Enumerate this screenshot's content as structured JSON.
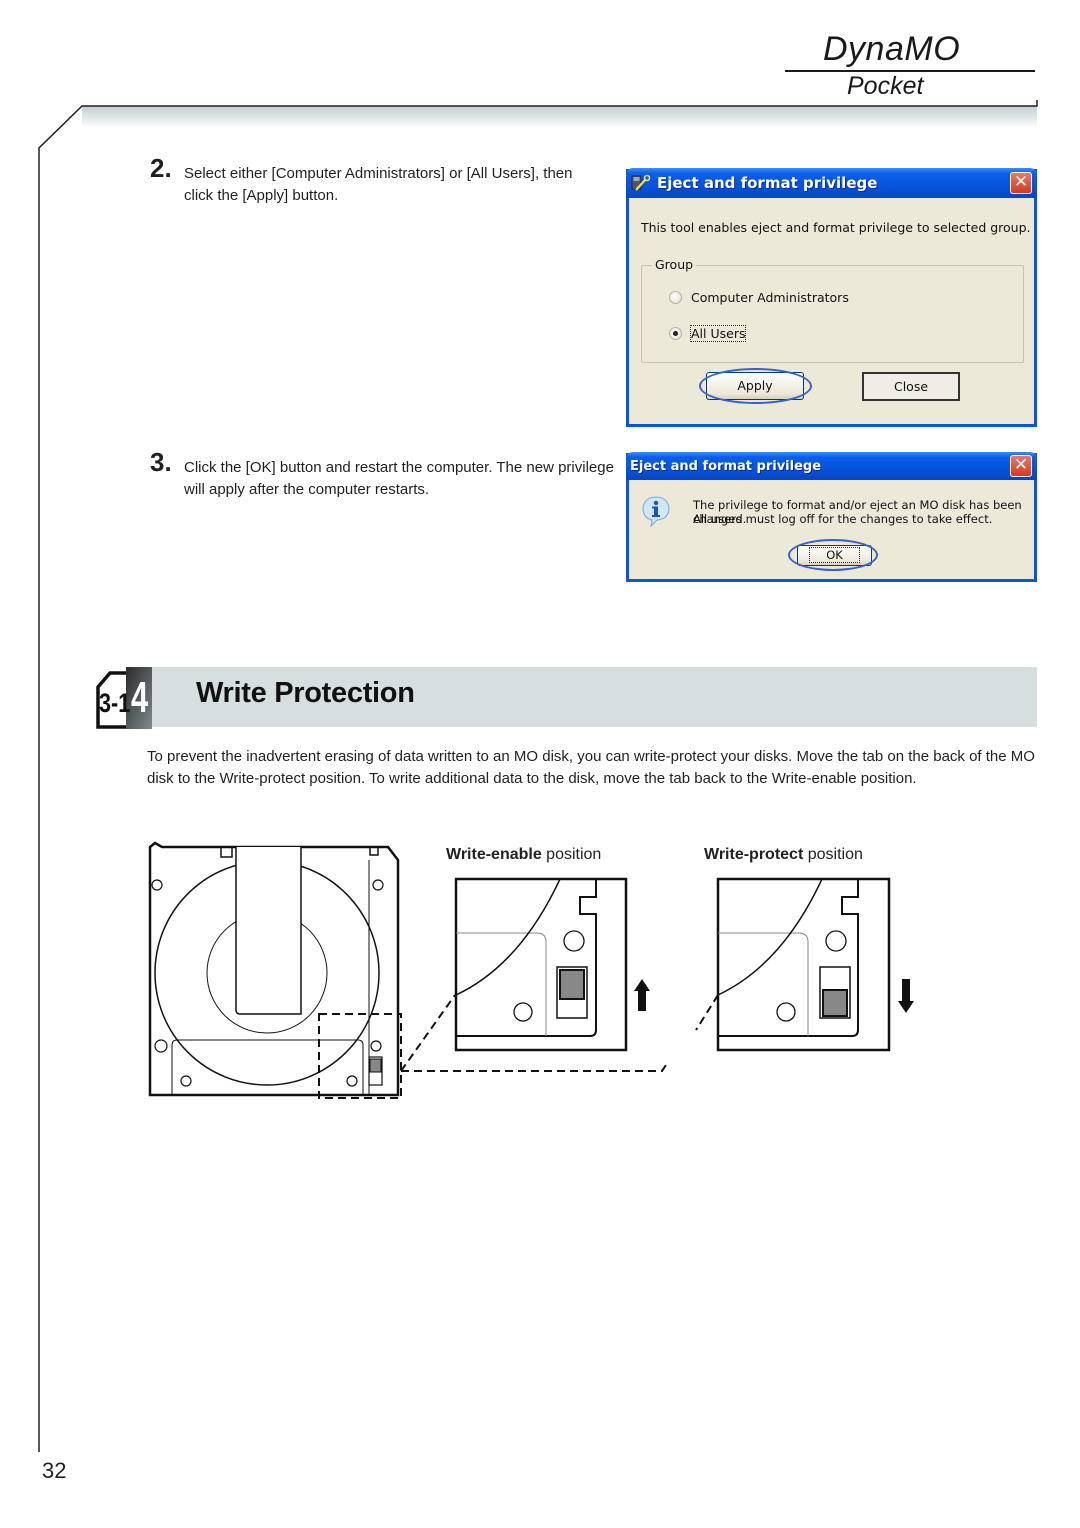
{
  "header": {
    "brand_title": "DynaMO",
    "brand_subtitle": "Pocket"
  },
  "steps": [
    {
      "number": "2.",
      "text": "Select either [Computer Administrators] or [All Users], then click the [Apply] button."
    },
    {
      "number": "3.",
      "text": "Click the [OK] button and restart the computer.  The new privilege will apply after the computer restarts."
    }
  ],
  "dialog_privilege": {
    "title": "Eject and format privilege",
    "icon": "key-tool-icon",
    "description": "This tool enables eject and format privilege to selected group.",
    "group_label": "Group",
    "options": [
      {
        "label": "Computer Administrators",
        "selected": false
      },
      {
        "label": "All Users",
        "selected": true
      }
    ],
    "apply_label": "Apply",
    "close_label": "Close",
    "close_glyph": "✕",
    "highlight_color": "#3a5fd0"
  },
  "dialog_confirm": {
    "title": "Eject and format privilege",
    "icon": "info-icon",
    "message_line1": "The privilege to format and/or eject an MO disk has been changed.",
    "message_line2": "All users must log off for the changes to take effect.",
    "ok_label": "OK",
    "close_glyph": "✕"
  },
  "section": {
    "chapter": "3-1",
    "number": "4",
    "title": "Write Protection",
    "paragraph": "To prevent the inadvertent erasing of data written to an MO disk, you can write-protect your disks.  Move the tab on the back of the MO disk to the Write-protect position.  To write additional data to the disk, move the tab back to the Write-enable position."
  },
  "figure": {
    "enable_label_bold": "Write-enable",
    "enable_label_rest": " position",
    "protect_label_bold": "Write-protect",
    "protect_label_rest": " position",
    "enable_arrow": "up",
    "protect_arrow": "down"
  },
  "footer": {
    "page_number": "32"
  }
}
